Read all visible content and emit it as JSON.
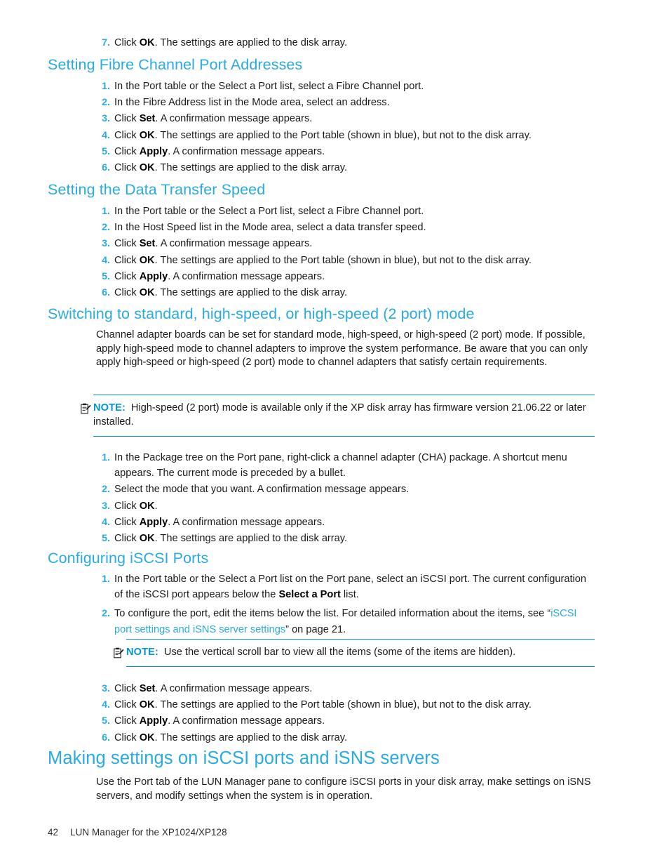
{
  "document": {
    "page_number": "42",
    "footer_title": "LUN Manager for the XP1024/XP128",
    "colors": {
      "heading": "#29ABE2",
      "note_label": "#0096D6",
      "note_rule": "#0096D6",
      "list_number": "#29ABE2",
      "body_text": "#1a1a1a",
      "xref_link": "#29ABE2"
    }
  },
  "top_step": {
    "num": "7.",
    "pre": "Click ",
    "bold": "OK",
    "post": ". The settings are applied to the disk array."
  },
  "sections": [
    {
      "id": "setting-fibre-channel-port-addresses",
      "heading": "Setting Fibre Channel Port Addresses",
      "steps": [
        {
          "num": "1.",
          "pre": "In the Port table or the Select a Port list, select a Fibre Channel port.",
          "bold": "",
          "post": ""
        },
        {
          "num": "2.",
          "pre": "In the Fibre Address list in the Mode area, select an address.",
          "bold": "",
          "post": ""
        },
        {
          "num": "3.",
          "pre": "Click ",
          "bold": "Set",
          "post": ". A confirmation message appears."
        },
        {
          "num": "4.",
          "pre": "Click ",
          "bold": "OK",
          "post": ". The settings are applied to the Port table (shown in blue), but not to the disk array."
        },
        {
          "num": "5.",
          "pre": "Click ",
          "bold": "Apply",
          "post": ". A confirmation message appears."
        },
        {
          "num": "6.",
          "pre": "Click ",
          "bold": "OK",
          "post": ". The settings are applied to the disk array."
        }
      ]
    },
    {
      "id": "setting-the-data-transfer-speed",
      "heading": "Setting the Data Transfer Speed",
      "steps": [
        {
          "num": "1.",
          "pre": "In the Port table or the Select a Port list, select a Fibre Channel port.",
          "bold": "",
          "post": ""
        },
        {
          "num": "2.",
          "pre": "In the Host Speed list in the Mode area, select a data transfer speed.",
          "bold": "",
          "post": ""
        },
        {
          "num": "3.",
          "pre": "Click ",
          "bold": "Set",
          "post": ". A confirmation message appears."
        },
        {
          "num": "4.",
          "pre": "Click ",
          "bold": "OK",
          "post": ". The settings are applied to the Port table (shown in blue), but not to the disk array."
        },
        {
          "num": "5.",
          "pre": "Click ",
          "bold": "Apply",
          "post": ". A confirmation message appears."
        },
        {
          "num": "6.",
          "pre": "Click ",
          "bold": "OK",
          "post": ". The settings are applied to the disk array."
        }
      ]
    }
  ],
  "switching": {
    "heading": "Switching to standard, high-speed, or high-speed (2 port) mode",
    "paragraph": "Channel adapter boards can be set for standard mode, high-speed, or high-speed (2 port) mode. If possible, apply high-speed mode to channel adapters to improve the system performance. Be aware that you can only apply high-speed or high-speed (2 port) mode to channel adapters that satisfy certain requirements.",
    "note": {
      "icon": "note-clipboard-icon",
      "label": "NOTE:",
      "text": "High-speed (2 port) mode is available only if the XP disk array has firmware version 21.06.22 or later installed."
    },
    "steps": [
      {
        "num": "1.",
        "pre": "In the Package tree on the Port pane, right-click a channel adapter (CHA) package. A shortcut menu appears. The current mode is preceded by a bullet.",
        "bold": "",
        "post": ""
      },
      {
        "num": "2.",
        "pre": "Select the mode that you want. A confirmation message appears.",
        "bold": "",
        "post": ""
      },
      {
        "num": "3.",
        "pre": "Click ",
        "bold": "OK",
        "post": "."
      },
      {
        "num": "4.",
        "pre": "Click ",
        "bold": "Apply",
        "post": ". A confirmation message appears."
      },
      {
        "num": "5.",
        "pre": "Click ",
        "bold": "OK",
        "post": ". The settings are applied to the disk array."
      }
    ]
  },
  "configuring_iscsi": {
    "heading": "Configuring iSCSI Ports",
    "step1": {
      "num": "1.",
      "pre": "In the Port table or the Select a Port list on the Port pane, select an iSCSI port. The current configuration of the iSCSI port appears below the ",
      "bold": "Select a Port",
      "post": " list."
    },
    "step2": {
      "num": "2.",
      "pre": "To configure the port, edit the items below the list. For detailed information about the items, see “",
      "xref": "iSCSI port settings and iSNS server settings",
      "post": "” on page 21."
    },
    "note": {
      "icon": "note-clipboard-icon",
      "label": "NOTE:",
      "text": "Use the vertical scroll bar to view all the items (some of the items are hidden)."
    },
    "steps_after_note": [
      {
        "num": "3.",
        "pre": "Click ",
        "bold": "Set",
        "post": ". A confirmation message appears."
      },
      {
        "num": "4.",
        "pre": "Click ",
        "bold": "OK",
        "post": ". The settings are applied to the Port table (shown in blue), but not to the disk array."
      },
      {
        "num": "5.",
        "pre": "Click ",
        "bold": "Apply",
        "post": ". A confirmation message appears."
      },
      {
        "num": "6.",
        "pre": "Click ",
        "bold": "OK",
        "post": ". The settings are applied to the disk array."
      }
    ]
  },
  "making_settings": {
    "heading": "Making settings on iSCSI ports and iSNS servers",
    "paragraph": "Use the Port tab of the LUN Manager pane to configure iSCSI ports in your disk array, make settings on iSNS servers, and modify settings when the system is in operation."
  }
}
